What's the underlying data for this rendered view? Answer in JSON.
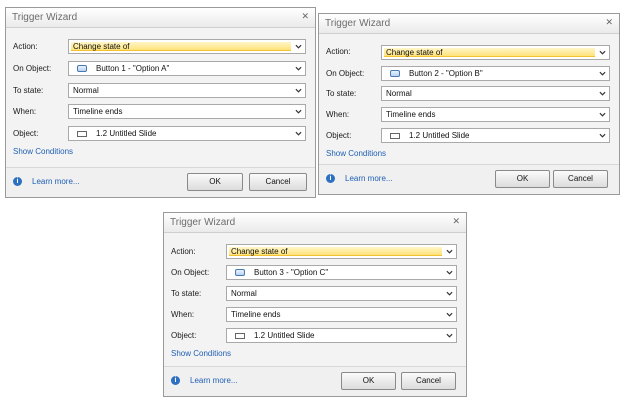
{
  "dialogs": [
    {
      "title": "Trigger Wizard",
      "labels": {
        "action": "Action:",
        "on_object": "On Object:",
        "to_state": "To state:",
        "when": "When:",
        "object": "Object:"
      },
      "action": "Change state of",
      "on_object": "Button 1 - \"Option A\"",
      "to_state": "Normal",
      "when": "Timeline ends",
      "object": "1.2 Untitled Slide",
      "show_conditions": "Show Conditions",
      "learn_more": "Learn more...",
      "ok": "OK",
      "cancel": "Cancel"
    },
    {
      "title": "Trigger Wizard",
      "labels": {
        "action": "Action:",
        "on_object": "On Object:",
        "to_state": "To state:",
        "when": "When:",
        "object": "Object:"
      },
      "action": "Change state of",
      "on_object": "Button 2 - \"Option B\"",
      "to_state": "Normal",
      "when": "Timeline ends",
      "object": "1.2 Untitled Slide",
      "show_conditions": "Show Conditions",
      "learn_more": "Learn more...",
      "ok": "OK",
      "cancel": "Cancel"
    },
    {
      "title": "Trigger Wizard",
      "labels": {
        "action": "Action:",
        "on_object": "On Object:",
        "to_state": "To state:",
        "when": "When:",
        "object": "Object:"
      },
      "action": "Change state of",
      "on_object": "Button 3 - \"Option C\"",
      "to_state": "Normal",
      "when": "Timeline ends",
      "object": "1.2 Untitled Slide",
      "show_conditions": "Show Conditions",
      "learn_more": "Learn more...",
      "ok": "OK",
      "cancel": "Cancel"
    }
  ],
  "icons": {
    "close": "close-icon",
    "dropdown": "chevron-down-icon",
    "button_object": "button-object-icon",
    "slide_object": "slide-icon",
    "info": "info-icon"
  },
  "colors": {
    "highlight": "#ffe27a",
    "link": "#1f5fb4",
    "info": "#2d6fc0"
  }
}
